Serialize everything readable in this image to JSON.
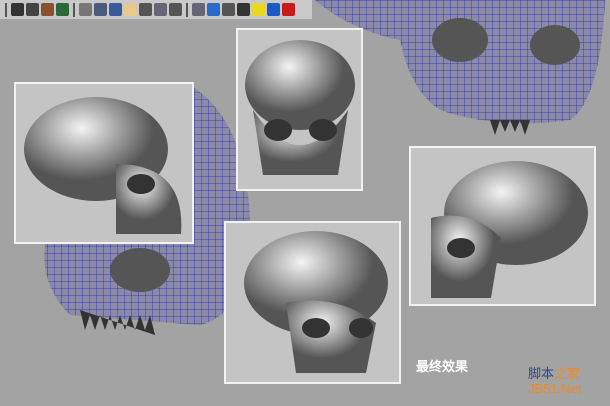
{
  "toolbar": {
    "icons": [
      "render-icon",
      "ipr-render-icon",
      "render-settings-icon",
      "hypershade-icon",
      "grid-icon",
      "camera-icon",
      "snapshot-icon",
      "light-icon",
      "uv-icon",
      "film-gate-icon",
      "resolution-gate-icon",
      "wireframe-icon",
      "smooth-shade-icon",
      "wire-on-shaded-icon",
      "texture-icon",
      "lighting-icon",
      "shadow-icon",
      "xray-icon"
    ]
  },
  "caption": "最终效果",
  "watermark": {
    "line1a": "脚本",
    "line1b": "之家",
    "line2": "JB51.Net"
  },
  "colors": {
    "wire": "#2a2ab0",
    "panel_bg": "#c4c4c4",
    "background": "#a3a3a3"
  }
}
